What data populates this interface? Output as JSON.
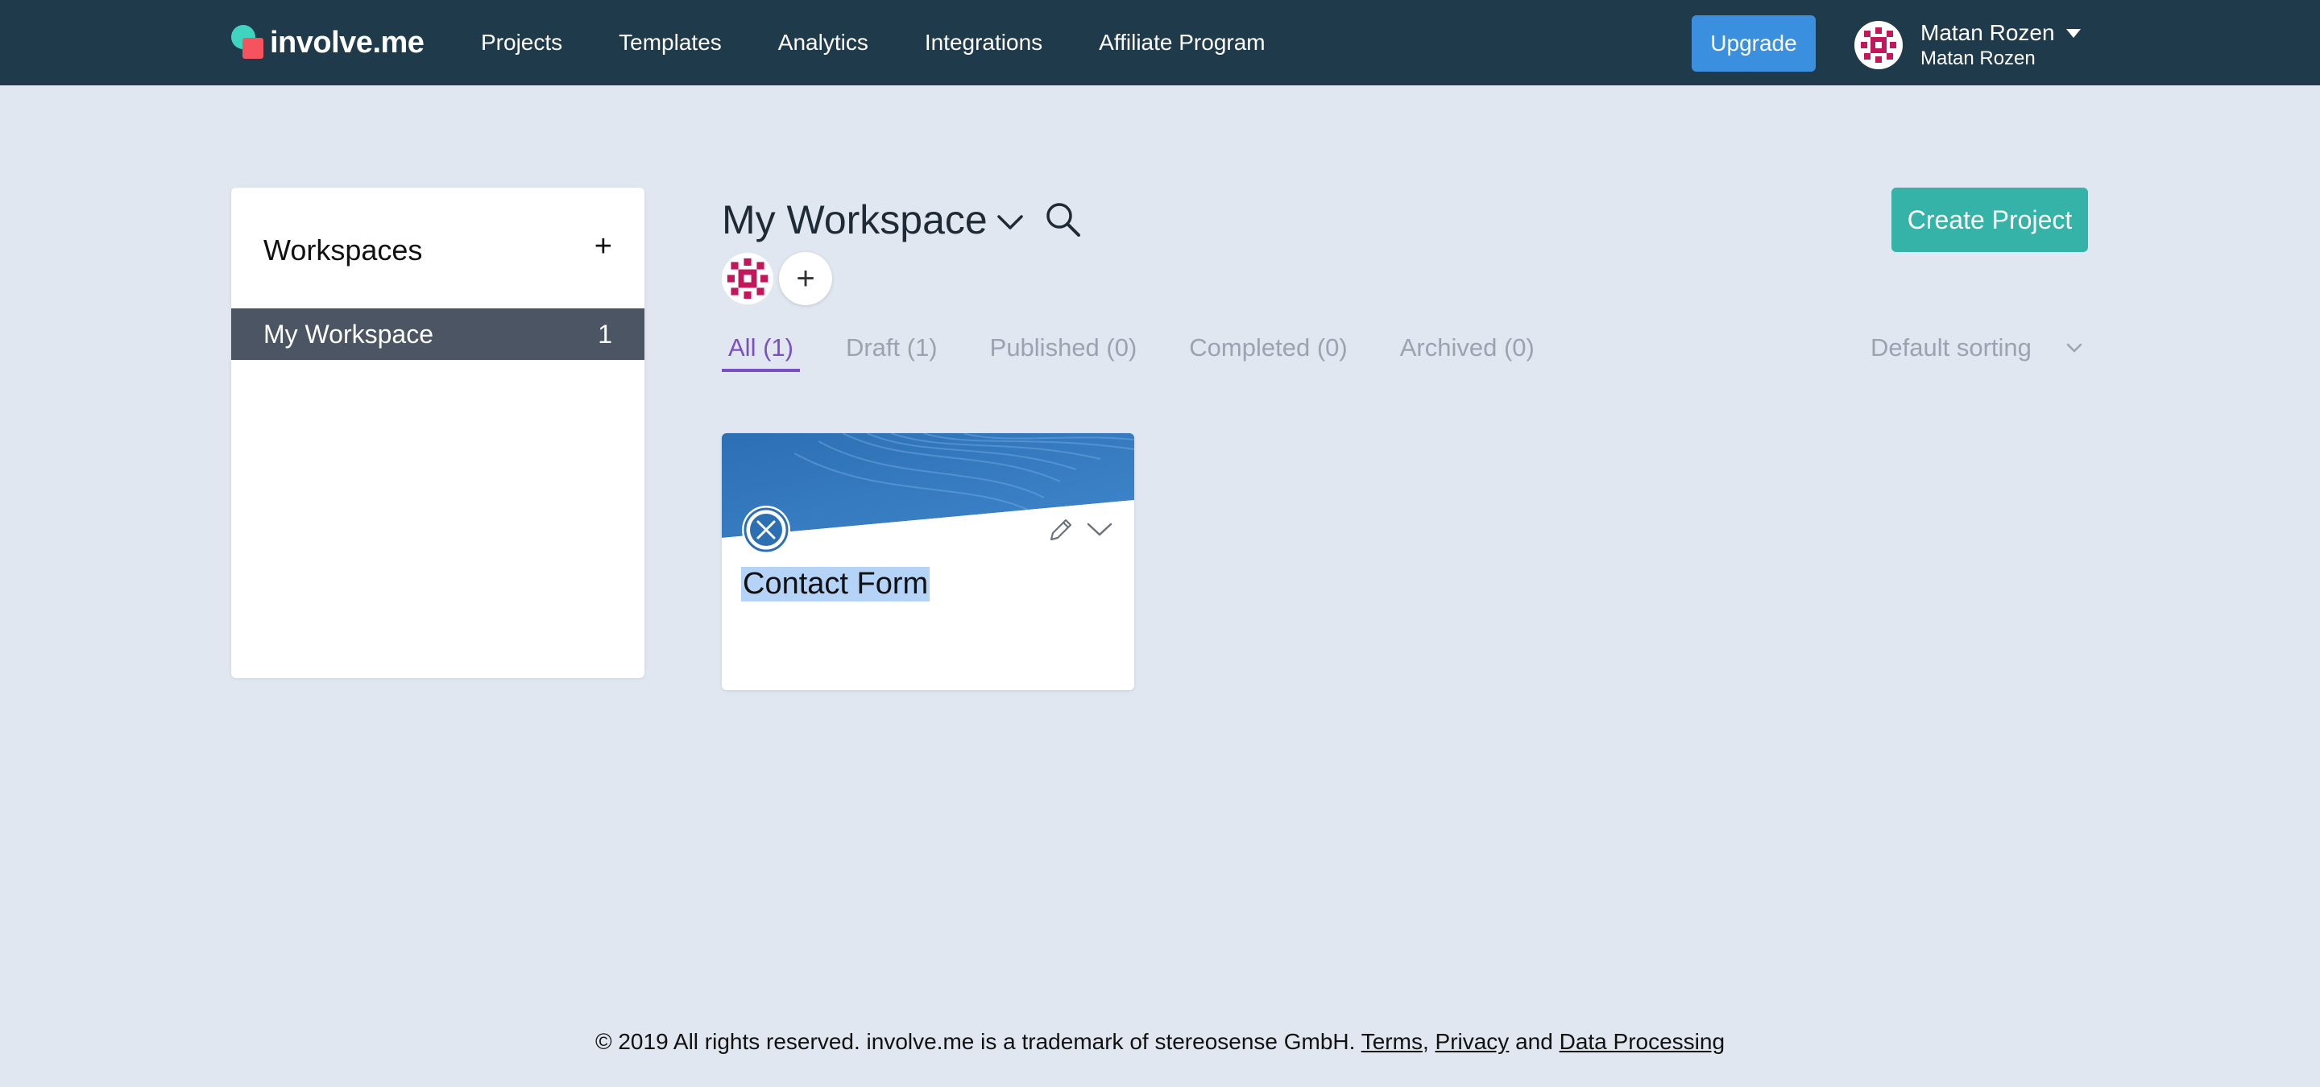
{
  "brand": {
    "name": "involve.me"
  },
  "nav": {
    "items": [
      {
        "label": "Projects"
      },
      {
        "label": "Templates"
      },
      {
        "label": "Analytics"
      },
      {
        "label": "Integrations"
      },
      {
        "label": "Affiliate Program"
      }
    ],
    "upgrade_label": "Upgrade"
  },
  "user": {
    "name": "Matan Rozen",
    "subtitle": "Matan Rozen"
  },
  "sidebar": {
    "title": "Workspaces",
    "add_label": "+",
    "items": [
      {
        "label": "My Workspace",
        "count": "1",
        "active": true
      }
    ]
  },
  "workspace": {
    "title": "My Workspace",
    "add_member_label": "+",
    "create_project_label": "Create Project",
    "tabs": [
      {
        "label": "All (1)",
        "active": true
      },
      {
        "label": "Draft (1)"
      },
      {
        "label": "Published (0)"
      },
      {
        "label": "Completed (0)"
      },
      {
        "label": "Archived (0)"
      }
    ],
    "sorting": {
      "selected": "Default sorting"
    }
  },
  "projects": [
    {
      "title": "Contact Form"
    }
  ],
  "footer": {
    "text": "© 2019 All rights reserved. involve.me is a trademark of stereosense GmbH.",
    "links": {
      "terms": "Terms",
      "privacy": "Privacy",
      "data_processing": "Data Processing"
    },
    "sep_comma": ",",
    "sep_and": "and"
  },
  "colors": {
    "topbar": "#1f3a4b",
    "page_bg": "#e1e7f0",
    "upgrade": "#3a90df",
    "create": "#36b3a8",
    "active_tab": "#7b4fc4",
    "sidebar_active": "#4b5563"
  },
  "icons": {
    "logo": "involve-logo-icon",
    "search": "search-icon",
    "chevron": "chevron-down-icon",
    "edit": "pencil-icon",
    "project_type": "pencil-ruler-icon"
  }
}
